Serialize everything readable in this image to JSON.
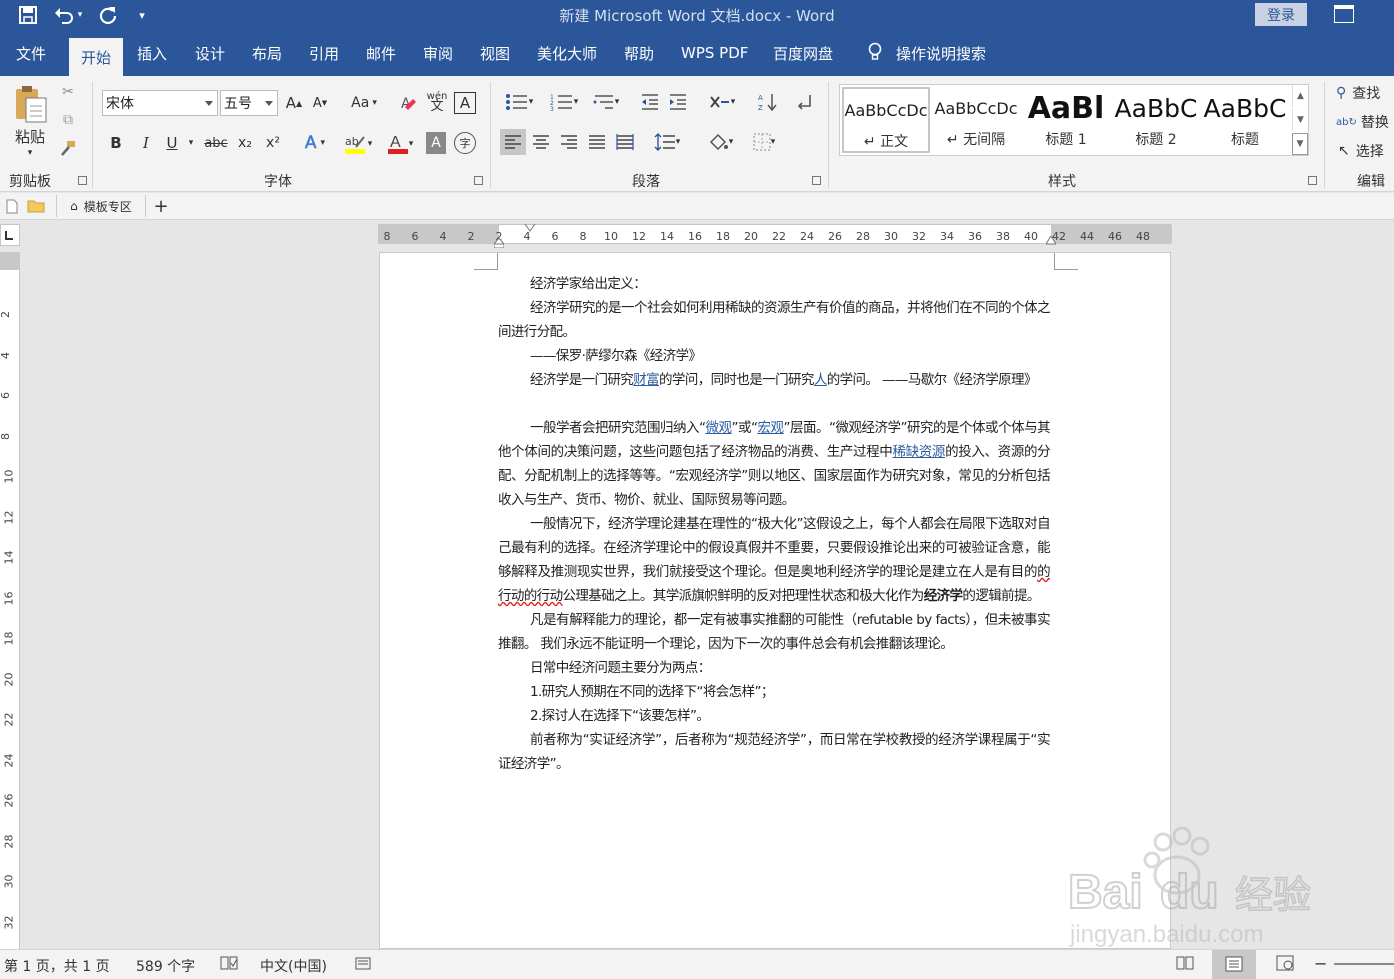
{
  "titlebar": {
    "title": "新建 Microsoft Word 文档.docx  -  Word",
    "login": "登录",
    "save_icon": "save-icon",
    "undo_icon": "undo-icon",
    "redo_icon": "redo-icon"
  },
  "tabs": [
    "文件",
    "开始",
    "插入",
    "设计",
    "布局",
    "引用",
    "邮件",
    "审阅",
    "视图",
    "美化大师",
    "帮助",
    "WPS PDF",
    "百度网盘",
    "操作说明搜索"
  ],
  "ribbon": {
    "clipboard": {
      "paste": "粘贴",
      "label": "剪贴板"
    },
    "font": {
      "name": "宋体",
      "size": "五号",
      "label": "字体",
      "grow": "A",
      "shrink": "A",
      "case": "Aa",
      "bold": "B",
      "italic": "I",
      "underline": "U",
      "strike": "abc",
      "sub": "x₂",
      "sup": "x²",
      "color_letter": "A",
      "shade_letter": "A",
      "phonetic": "wén",
      "circle": "字"
    },
    "paragraph": {
      "label": "段落"
    },
    "styles": {
      "label": "样式",
      "items": [
        {
          "preview": "AaBbCcDc",
          "name": "↵ 正文"
        },
        {
          "preview": "AaBbCcDc",
          "name": "↵ 无间隔"
        },
        {
          "preview": "AaBl",
          "name": "标题 1"
        },
        {
          "preview": "AaBbC",
          "name": "标题 2"
        },
        {
          "preview": "AaBbC",
          "name": "标题"
        }
      ]
    },
    "editing": {
      "label": "编辑",
      "find": "查找",
      "replace": "替换",
      "select": "选择"
    }
  },
  "docbar": {
    "template": "模板专区",
    "add": "+"
  },
  "ruler": {
    "h_ticks": [
      "8",
      "6",
      "4",
      "2",
      "2",
      "4",
      "6",
      "8",
      "10",
      "12",
      "14",
      "16",
      "18",
      "20",
      "22",
      "24",
      "26",
      "28",
      "30",
      "32",
      "34",
      "36",
      "38",
      "40",
      "42",
      "44",
      "46",
      "48"
    ],
    "v_ticks": [
      "2",
      "4",
      "6",
      "8",
      "10",
      "12",
      "14",
      "16",
      "18",
      "20",
      "22",
      "24",
      "26",
      "28",
      "30",
      "32"
    ]
  },
  "document": {
    "p1": "经济学家给出定义：",
    "p2": "经济学研究的是一个社会如何利用稀缺的资源生产有价值的商品，并将他们在不同的个体之间进行分配。",
    "p3": "——保罗·萨缪尔森《经济学》",
    "p4a": "经济学是一门研究",
    "p4l1": "财富",
    "p4b": "的学问，同时也是一门研究",
    "p4l2": "人",
    "p4c": "的学问。 ——马歇尔《经济学原理》",
    "p5a": "一般学者会把研究范围归纳入“",
    "p5l1": "微观",
    "p5b": "”或“",
    "p5l2": "宏观",
    "p5c": "”层面。“微观经济学”研究的是个体或个体与其他个体间的决策问题，这些问题包括了经济物品的消费、生产过程中",
    "p5l3": "稀缺资源",
    "p5d": "的投入、资源的分配、分配机制上的选择等等。“宏观经济学”则以地区、国家层面作为研究对象，常见的分析包括收入与生产、货币、物价、就业、国际贸易等问题。",
    "p6a": "一般情况下，经济学理论建基在理性的“极大化”这假设之上，每个人都会在局限下选取对自己最有利的选择。在经济学理论中的假设真假并不重要，只要假设推论出来的可被验证含意，能够解释及推测现实世界，我们就接受这个理论。但是奥地利经济学的理论是建立在人是有目的",
    "p6s": "的行动的行动",
    "p6b": "公理基础之上。其学派旗帜鲜明的反对把理性状态和极大化作为",
    "p6bold": "经济学",
    "p6c": "的逻辑前提。",
    "p7": "凡是有解释能力的理论，都一定有被事实推翻的可能性（refutable by facts），但未被事实推翻。 我们永远不能证明一个理论，因为下一次的事件总会有机会推翻该理论。",
    "p8": "日常中经济问题主要分为两点：",
    "p9": "1.研究人预期在不同的选择下“将会怎样”；",
    "p10": "2.探讨人在选择下“该要怎样”。",
    "p11": "前者称为“实证经济学”，后者称为“规范经济学”，而日常在学校教授的经济学课程属于“实证经济学”。"
  },
  "status": {
    "page": "第 1 页，共 1 页",
    "words": "589 个字",
    "lang": "中文(中国)"
  },
  "watermark": {
    "brand": "Bai",
    "brand2": "du",
    "cn": "经验",
    "url": "jingyan.baidu.com"
  },
  "colors": {
    "accent": "#2b579a",
    "ribbon_bg": "#f3f3f3",
    "link": "#2b5ba0",
    "font_color_bar": "#e02020",
    "highlight_bar": "#ffff00"
  }
}
